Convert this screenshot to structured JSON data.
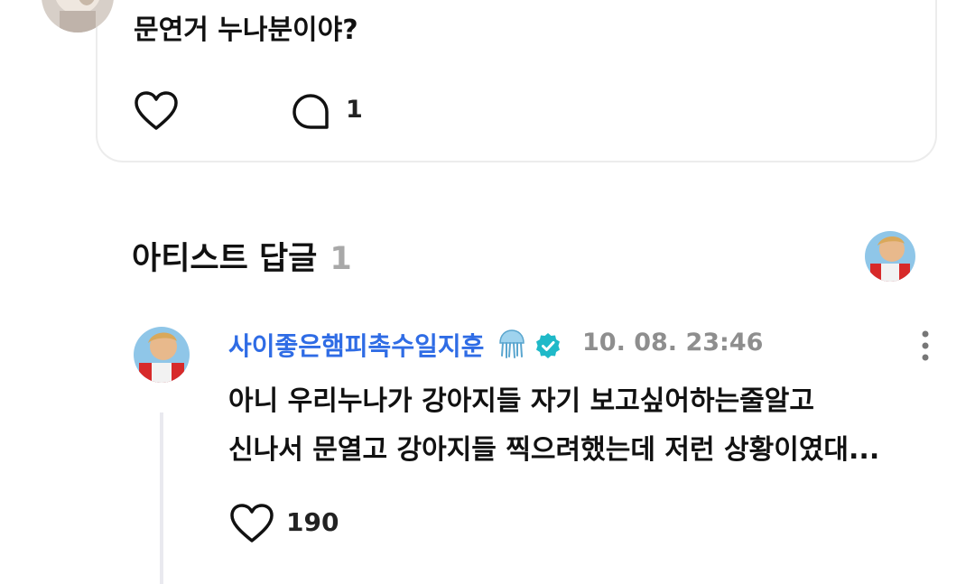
{
  "post": {
    "text": "문연거 누나분이야?",
    "comment_count": "1"
  },
  "artist_replies": {
    "title": "아티스트 답글",
    "count": "1"
  },
  "reply": {
    "author": "사이좋은햄피촉수일지훈",
    "author_icon": "jellyfish-emoji",
    "verified_icon": "verified-badge-icon",
    "timestamp": "10. 08. 23:46",
    "line1": "아니 우리누나가 강아지들 자기 보고싶어하는줄알고",
    "line2": "신나서 문열고 강아지들 찍으려했는데 저런 상황이였대...",
    "like_count": "190"
  },
  "colors": {
    "author_blue": "#2f6ce5",
    "verified_teal": "#1fb9c8",
    "muted_gray": "#8e8e8e"
  }
}
